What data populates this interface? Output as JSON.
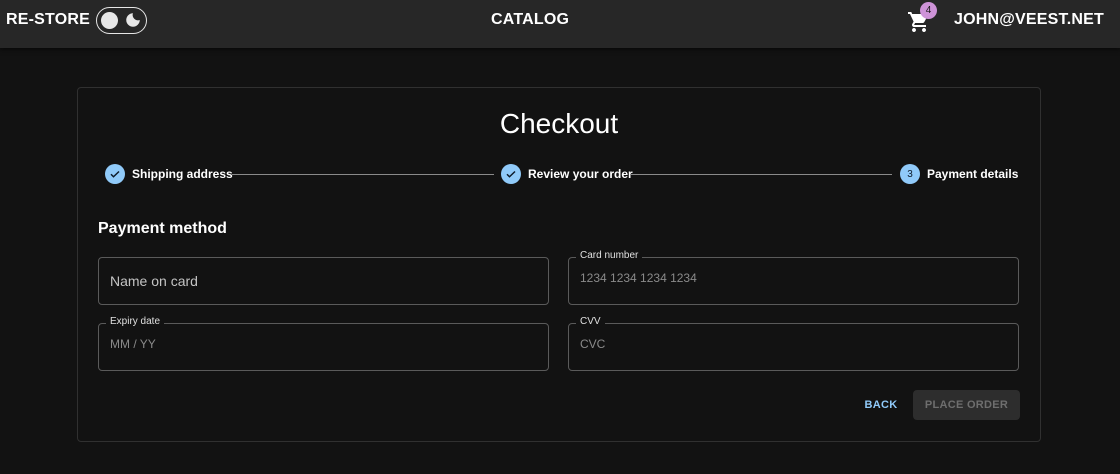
{
  "app": {
    "brand": "RE-STORE",
    "nav_catalog": "CATALOG",
    "cart_count": "4",
    "user_email": "JOHN@VEEST.NET"
  },
  "checkout": {
    "title": "Checkout",
    "steps": [
      {
        "label": "Shipping address",
        "state": "completed",
        "icon": "check-icon"
      },
      {
        "label": "Review your order",
        "state": "completed",
        "icon": "check-icon"
      },
      {
        "label": "Payment details",
        "state": "active",
        "number": "3"
      }
    ],
    "section_title": "Payment method",
    "fields": {
      "name_on_card": {
        "label": "Name on card"
      },
      "card_number": {
        "label": "Card number",
        "placeholder": "1234 1234 1234 1234"
      },
      "expiry": {
        "label": "Expiry date",
        "placeholder": "MM / YY"
      },
      "cvv": {
        "label": "CVV",
        "placeholder": "CVC"
      }
    },
    "buttons": {
      "back": "BACK",
      "place_order": "PLACE ORDER"
    }
  },
  "colors": {
    "background": "#121212",
    "appbar": "#272727",
    "accent": "#90caf9",
    "badge": "#ce93d8"
  }
}
